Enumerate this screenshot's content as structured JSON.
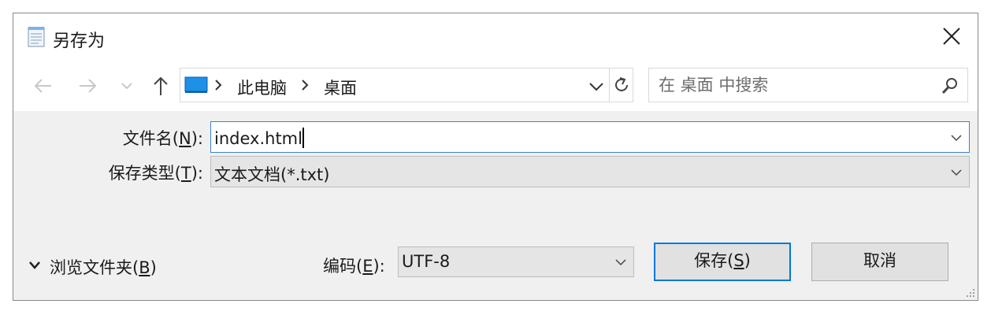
{
  "window": {
    "title": "另存为",
    "app_icon": "notepad-icon"
  },
  "navigation": {
    "back_icon": "arrow-left-icon",
    "forward_icon": "arrow-right-icon",
    "recent_icon": "chevron-down-icon",
    "up_icon": "arrow-up-icon"
  },
  "address": {
    "crumbs": [
      "此电脑",
      "桌面"
    ]
  },
  "search": {
    "placeholder": "在 桌面 中搜索"
  },
  "filename": {
    "label_pre": "文件名(",
    "label_key": "N",
    "label_post": "):",
    "value": "index.html"
  },
  "filetype": {
    "label_pre": "保存类型(",
    "label_key": "T",
    "label_post": "):",
    "value": "文本文档(*.txt)"
  },
  "browse": {
    "label_pre": "浏览文件夹(",
    "label_key": "B",
    "label_post": ")"
  },
  "encoding": {
    "label_pre": "编码(",
    "label_key": "E",
    "label_post": "):",
    "value": "UTF-8"
  },
  "buttons": {
    "save_pre": "保存(",
    "save_key": "S",
    "save_post": ")",
    "cancel": "取消"
  },
  "colors": {
    "accent": "#0078d7",
    "dialog_bg": "#f0f0f0",
    "focus_border": "#3c7fd4"
  }
}
